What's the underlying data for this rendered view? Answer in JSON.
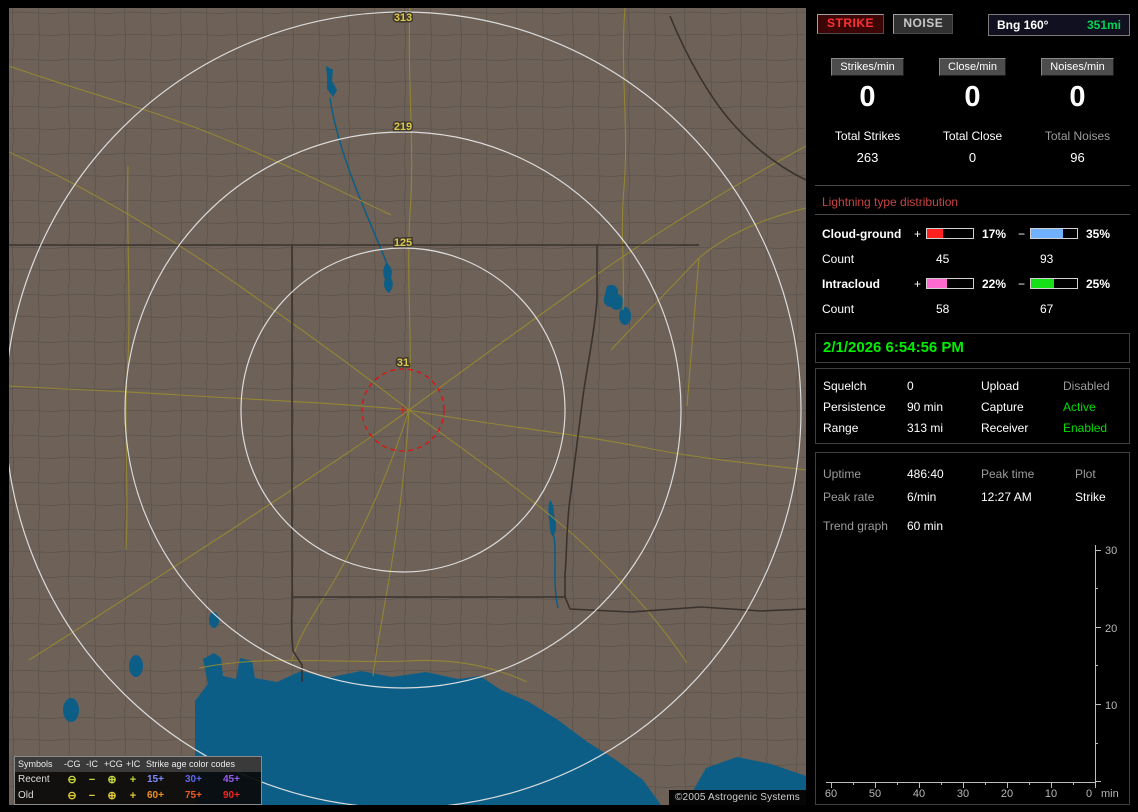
{
  "map": {
    "ring_labels": [
      "313",
      "219",
      "125",
      "31"
    ],
    "copyright": "©2005 Astrogenic Systems",
    "legend": {
      "symbols_header": "Symbols",
      "cols": [
        "-CG",
        "-IC",
        "+CG",
        "+IC"
      ],
      "age_header": "Strike age color codes",
      "icons": [
        "⊖",
        "−",
        "⊕",
        "+"
      ],
      "rows": [
        {
          "label": "Recent",
          "icon_color": "#c6d83a",
          "ages": [
            {
              "text": "15+",
              "color": "#7d8cff"
            },
            {
              "text": "30+",
              "color": "#5a66f0"
            },
            {
              "text": "45+",
              "color": "#9a5df0"
            }
          ]
        },
        {
          "label": "Old",
          "icon_color": "#e0cc34",
          "ages": [
            {
              "text": "60+",
              "color": "#f09020"
            },
            {
              "text": "75+",
              "color": "#f05a20"
            },
            {
              "text": "90+",
              "color": "#f02820"
            }
          ]
        }
      ]
    }
  },
  "panel": {
    "strike_button": "STRIKE",
    "noise_button": "NOISE",
    "bearing": {
      "label": "Bng 160°",
      "value": "351mi",
      "value_color": "#00d455"
    },
    "counters": [
      {
        "label": "Strikes/min",
        "value": "0"
      },
      {
        "label": "Close/min",
        "value": "0"
      },
      {
        "label": "Noises/min",
        "value": "0"
      }
    ],
    "totals": [
      {
        "label": "Total Strikes",
        "value": "263"
      },
      {
        "label": "Total Close",
        "value": "0"
      },
      {
        "label": "Total Noises",
        "value": "96"
      }
    ],
    "distribution": {
      "title": "Lightning type distribution",
      "rows": [
        {
          "label": "Cloud-ground",
          "plus": "+",
          "minus": "−",
          "pos": {
            "pct": "17%",
            "fill": 34,
            "color": "#ff2020"
          },
          "neg": {
            "pct": "35%",
            "fill": 70,
            "color": "#6fb0ff"
          },
          "count_label": "Count",
          "pos_count": "45",
          "neg_count": "93"
        },
        {
          "label": "Intracloud",
          "plus": "+",
          "minus": "−",
          "pos": {
            "pct": "22%",
            "fill": 44,
            "color": "#ff6ad0"
          },
          "neg": {
            "pct": "25%",
            "fill": 50,
            "color": "#18e018"
          },
          "count_label": "Count",
          "pos_count": "58",
          "neg_count": "67"
        }
      ]
    },
    "clock": "2/1/2026 6:54:56 PM",
    "settings": [
      {
        "l1": "Squelch",
        "v1": "0",
        "l2": "Upload",
        "v2": "Disabled",
        "v2_color": "#9a9a9a"
      },
      {
        "l1": "Persistence",
        "v1": "90 min",
        "l2": "Capture",
        "v2": "Active",
        "v2_color": "#00dd00"
      },
      {
        "l1": "Range",
        "v1": "313 mi",
        "l2": "Receiver",
        "v2": "Enabled",
        "v2_color": "#00dd00"
      }
    ],
    "stats": {
      "r1": [
        "Uptime",
        "486:40",
        "Peak time",
        "Plot"
      ],
      "r2": [
        "Peak rate",
        "6/min",
        "12:27 AM",
        "Strike"
      ],
      "trend_label": "Trend graph",
      "trend_value": "60 min"
    },
    "trend_graph": {
      "y_ticks": [
        "30",
        "20",
        "10"
      ],
      "x_ticks": [
        "60",
        "50",
        "40",
        "30",
        "20",
        "10",
        "0"
      ],
      "x_unit": "min"
    }
  },
  "chart_data": {
    "type": "line",
    "title": "Trend graph (60 min)",
    "xlabel": "min",
    "ylabel": "",
    "x_ticks": [
      60,
      50,
      40,
      30,
      20,
      10,
      0
    ],
    "ylim": [
      0,
      30
    ],
    "series": [],
    "note": "trend graph currently empty - no plotted strike-rate data"
  }
}
